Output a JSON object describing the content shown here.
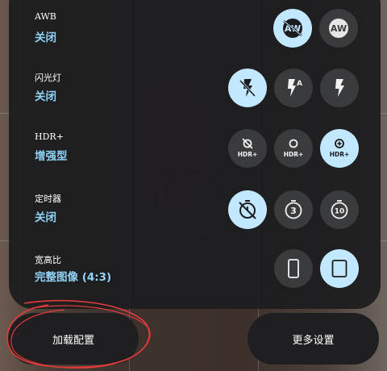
{
  "settings": {
    "awb": {
      "title": "AWB",
      "value": "关闭"
    },
    "flash": {
      "title": "闪光灯",
      "value": "关闭"
    },
    "hdr": {
      "title": "HDR+",
      "value": "增强型",
      "badge_label": "HDR+"
    },
    "timer": {
      "title": "定时器",
      "value": "关闭",
      "options": [
        "3",
        "10"
      ]
    },
    "ratio": {
      "title": "宽高比",
      "value": "完整图像 (4:3)"
    }
  },
  "awb_icon_text": "AW",
  "flash_auto_letter": "A",
  "actions": {
    "load_config": "加载配置",
    "more_settings": "更多设置"
  },
  "icons": [
    "awb-off-icon",
    "awb-on-icon",
    "flash-off-icon",
    "flash-auto-icon",
    "flash-on-icon",
    "hdr-off-icon",
    "hdr-on-icon",
    "hdr-enhanced-icon",
    "timer-off-icon",
    "timer-3s-icon",
    "timer-10s-icon",
    "aspect-full-icon",
    "aspect-4x3-icon"
  ],
  "colors": {
    "accent": "#8fd3f7",
    "selected_bg": "#c2e8ff",
    "panel_bg": "#1c1c1e",
    "button_bg": "#3a3b3d",
    "annotation": "#e23b3b"
  }
}
